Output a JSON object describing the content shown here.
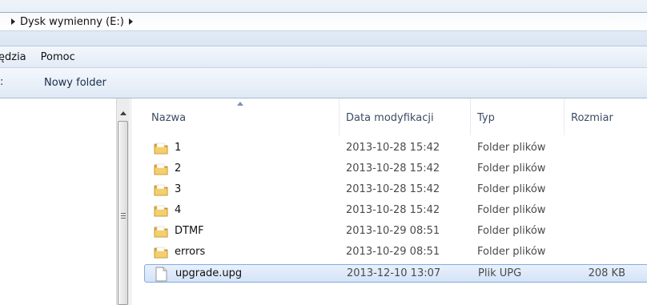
{
  "breadcrumb": {
    "items": [
      "Dysk wymienny (E:)"
    ]
  },
  "menubar": {
    "items": [
      "ędzia",
      "Pomoc"
    ]
  },
  "toolbar": {
    "new_folder": "Nowy folder",
    "separator": ":"
  },
  "filelist": {
    "columns": [
      "Nazwa",
      "Data modyfikacji",
      "Typ",
      "Rozmiar"
    ],
    "rows": [
      {
        "name": "1",
        "date": "2013-10-28 15:42",
        "type": "Folder plików",
        "size": "",
        "icon": "folder-icon"
      },
      {
        "name": "2",
        "date": "2013-10-28 15:42",
        "type": "Folder plików",
        "size": "",
        "icon": "folder-icon"
      },
      {
        "name": "3",
        "date": "2013-10-28 15:42",
        "type": "Folder plików",
        "size": "",
        "icon": "folder-icon"
      },
      {
        "name": "4",
        "date": "2013-10-28 15:42",
        "type": "Folder plików",
        "size": "",
        "icon": "folder-icon"
      },
      {
        "name": "DTMF",
        "date": "2013-10-29 08:51",
        "type": "Folder plików",
        "size": "",
        "icon": "folder-icon"
      },
      {
        "name": "errors",
        "date": "2013-10-29 08:51",
        "type": "Folder plików",
        "size": "",
        "icon": "folder-icon"
      },
      {
        "name": "upgrade.upg",
        "date": "2013-12-10 13:07",
        "type": "Plik UPG",
        "size": "208 KB",
        "icon": "file-icon",
        "selected": true
      }
    ]
  },
  "colors": {
    "selection_border": "#84acdd",
    "selection_fill": "#d3e3f8",
    "folder": "#e8b84a"
  }
}
